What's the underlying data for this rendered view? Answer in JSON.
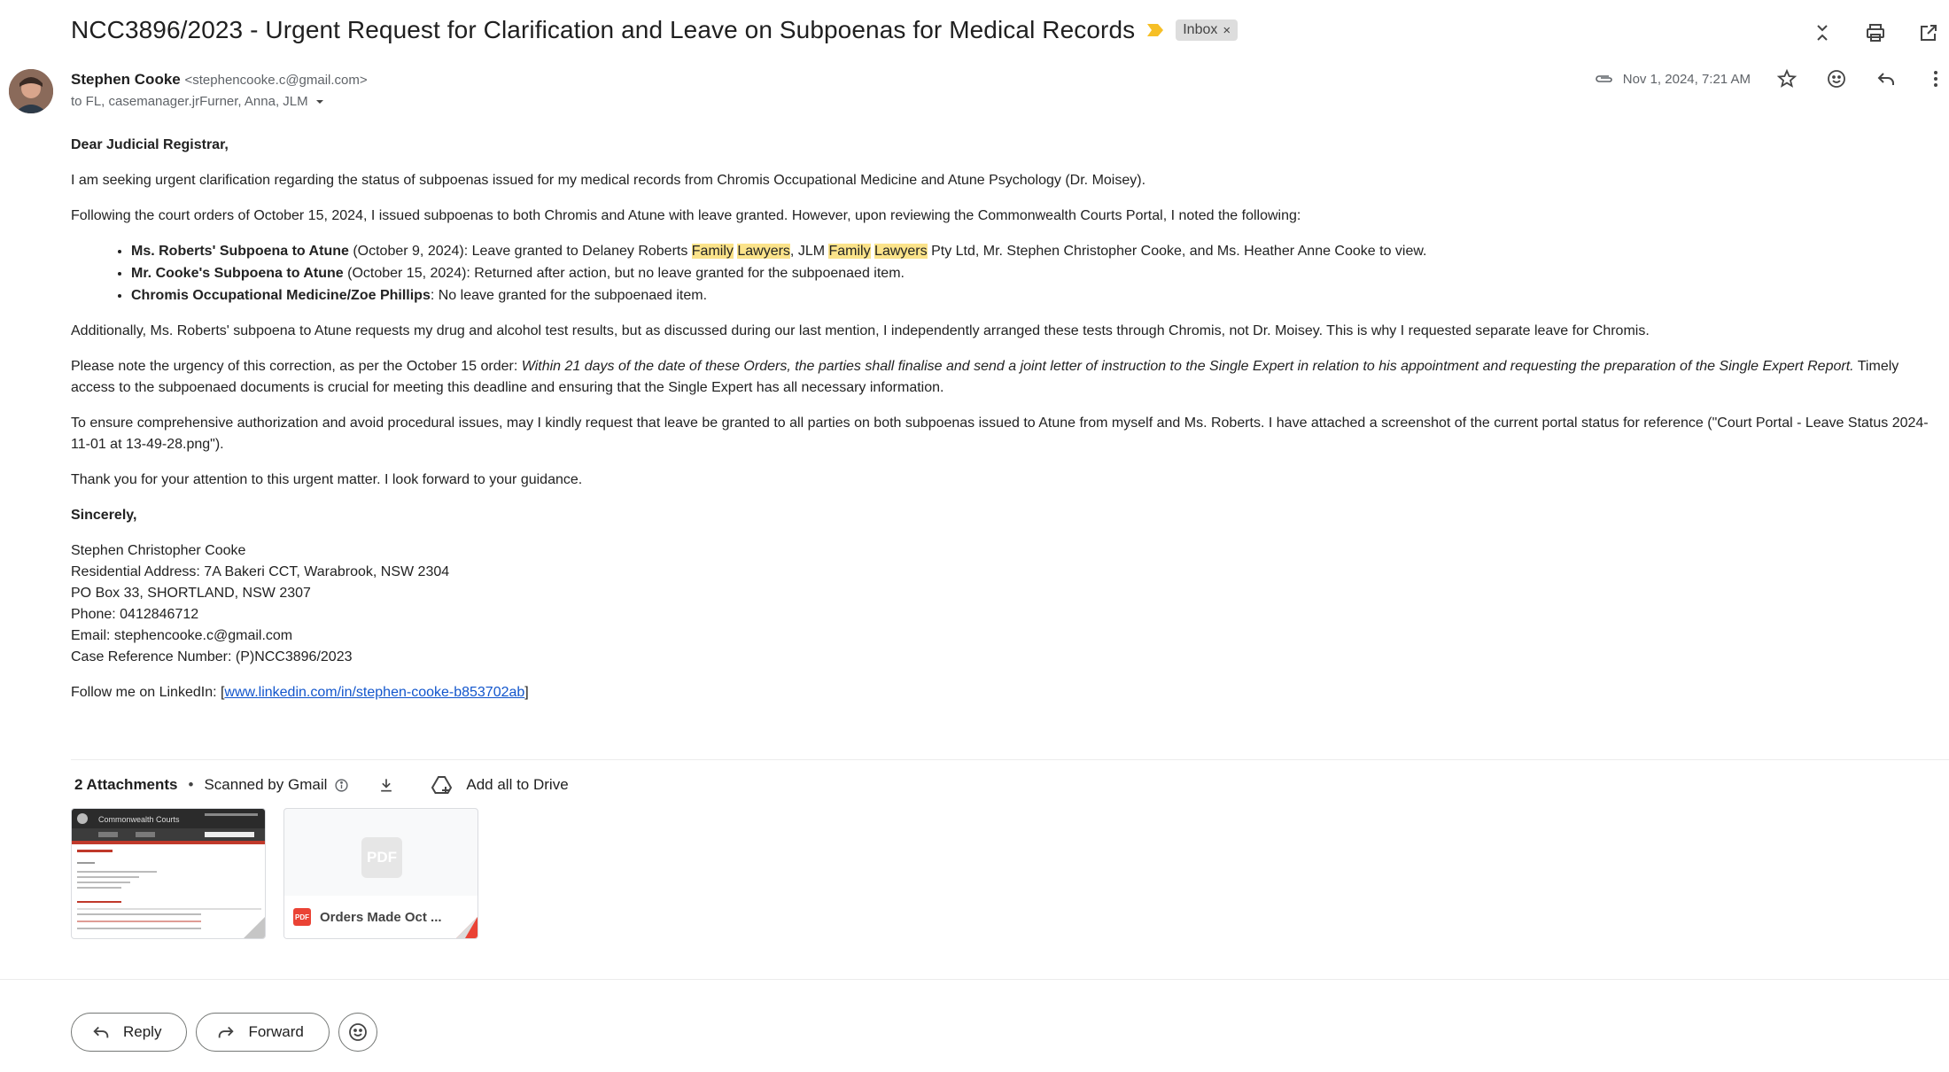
{
  "header": {
    "subject": "NCC3896/2023 - Urgent Request for Clarification and Leave on Subpoenas for Medical Records",
    "label": "Inbox",
    "label_remove": "×"
  },
  "sender": {
    "name": "Stephen Cooke",
    "email": "<stephencooke.c@gmail.com>",
    "recipients": "to FL, casemanager.jrFurner, Anna, JLM",
    "date": "Nov 1, 2024, 7:21 AM"
  },
  "body": {
    "greeting": "Dear Judicial Registrar,",
    "p1": "I am seeking urgent clarification regarding the status of subpoenas issued for my medical records from Chromis Occupational Medicine and Atune Psychology (Dr. Moisey).",
    "p2": "Following the court orders of October 15, 2024, I issued subpoenas to both Chromis and Atune with leave granted. However, upon reviewing the Commonwealth Courts Portal, I noted the following:",
    "b1_bold": "Ms. Roberts' Subpoena to Atune",
    "b1_a": " (October 9, 2024): Leave granted to Delaney Roberts ",
    "b1_hl1": "Family",
    "b1_sp1": " ",
    "b1_hl2": "Lawyers",
    "b1_b": ", JLM ",
    "b1_hl3": "Family",
    "b1_sp2": " ",
    "b1_hl4": "Lawyers",
    "b1_c": " Pty Ltd, Mr. Stephen Christopher Cooke, and Ms. Heather Anne Cooke to view.",
    "b2_bold": "Mr. Cooke's Subpoena to Atune",
    "b2_text": " (October 15, 2024): Returned after action, but no leave granted for the subpoenaed item.",
    "b3_bold": "Chromis Occupational Medicine/Zoe Phillips",
    "b3_text": ": No leave granted for the subpoenaed item.",
    "p3": "Additionally, Ms. Roberts' subpoena to Atune requests my drug and alcohol test results, but as discussed during our last mention, I independently arranged these tests through Chromis, not Dr. Moisey. This is why I requested separate leave for Chromis.",
    "p4_a": "Please note the urgency of this correction, as per the October 15 order: ",
    "p4_italic": "Within 21 days of the date of these Orders, the parties shall finalise and send a joint letter of instruction to the Single Expert in relation to his appointment and requesting the preparation of the Single Expert Report.",
    "p4_b": " Timely access to the subpoenaed documents is crucial for meeting this deadline and ensuring that the Single Expert has all necessary information.",
    "p5": "To ensure comprehensive authorization and avoid procedural issues, may I kindly request that leave be granted to all parties on both subpoenas issued to Atune from myself and Ms. Roberts. I have attached a screenshot of the current portal status for reference (\"Court Portal - Leave Status 2024-11-01 at 13-49-28.png\").",
    "p6": "Thank you for your attention to this urgent matter. I look forward to your guidance.",
    "closing": "Sincerely,",
    "sig_name": "Stephen Christopher Cooke",
    "sig_address": "Residential Address: 7A Bakeri CCT, Warabrook, NSW 2304",
    "sig_po": "PO Box 33, SHORTLAND, NSW 2307",
    "sig_phone": "Phone: 0412846712",
    "sig_email": "Email: stephencooke.c@gmail.com",
    "sig_case": "Case Reference Number: (P)NCC3896/2023",
    "linkedin_prefix": "Follow me on LinkedIn: [",
    "linkedin_url": "www.linkedin.com/in/stephen-cooke-b853702ab",
    "linkedin_suffix": "]"
  },
  "attachments": {
    "count_label": "2 Attachments",
    "separator": "•",
    "scanned": "Scanned by Gmail",
    "add_drive": "Add all to Drive",
    "files": [
      {
        "name": "Court Portal - Leave Status 2024-11-01 at 13-49-28.png",
        "thumb_header": "Commonwealth Courts"
      },
      {
        "name": "Orders Made Oct ...",
        "placeholder": "PDF",
        "badge": "PDF"
      }
    ]
  },
  "actions": {
    "reply": "Reply",
    "forward": "Forward"
  },
  "colors": {
    "highlight": "#fbe38a",
    "link": "#1155cc",
    "important_marker": "#f6bf26",
    "pdf_red": "#ea4335"
  },
  "icons": [
    "important-marker-icon",
    "collapse-icon",
    "print-icon",
    "open-new-window-icon",
    "attachment-icon",
    "star-icon",
    "emoji-icon",
    "reply-icon",
    "more-icon",
    "info-icon",
    "download-icon",
    "add-to-drive-icon",
    "chevron-down-icon"
  ]
}
